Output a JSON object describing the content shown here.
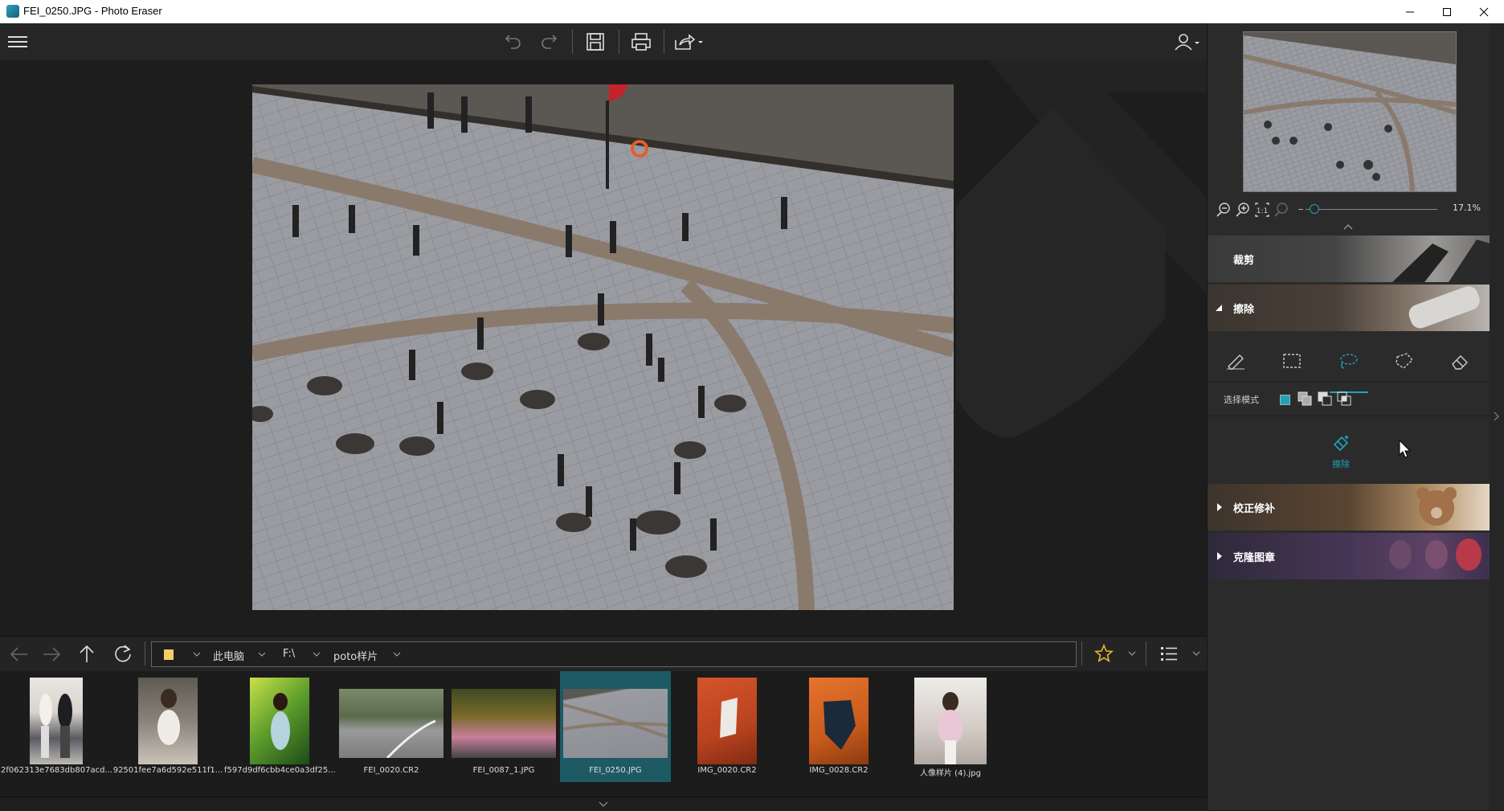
{
  "window": {
    "title": "FEI_0250.JPG - Photo Eraser"
  },
  "zoom": {
    "value": "17.1%",
    "slider_fraction": 0.06
  },
  "panel": {
    "sections": [
      {
        "label": "裁剪"
      },
      {
        "label": "擦除"
      },
      {
        "label": "校正修补"
      },
      {
        "label": "克隆图章"
      }
    ],
    "select_mode_label": "选择模式",
    "erase_action_label": "擦除"
  },
  "path": {
    "segments": [
      "此电脑",
      "F:\\",
      "poto样片"
    ]
  },
  "files": [
    {
      "name": "2f062313e7683db807acd...",
      "selected": false
    },
    {
      "name": "92501fee7a6d592e511f1...",
      "selected": false
    },
    {
      "name": "f597d9df6cbb4ce0a3df25...",
      "selected": false
    },
    {
      "name": "FEI_0020.CR2",
      "selected": false
    },
    {
      "name": "FEI_0087_1.JPG",
      "selected": false
    },
    {
      "name": "FEI_0250.JPG",
      "selected": true
    },
    {
      "name": "IMG_0020.CR2",
      "selected": false
    },
    {
      "name": "IMG_0028.CR2",
      "selected": false
    },
    {
      "name": "人像样片 (4).jpg",
      "selected": false
    }
  ],
  "colors": {
    "accent": "#1fa3b8",
    "selected_item": "#1d5a63",
    "star": "#e8b52a"
  }
}
